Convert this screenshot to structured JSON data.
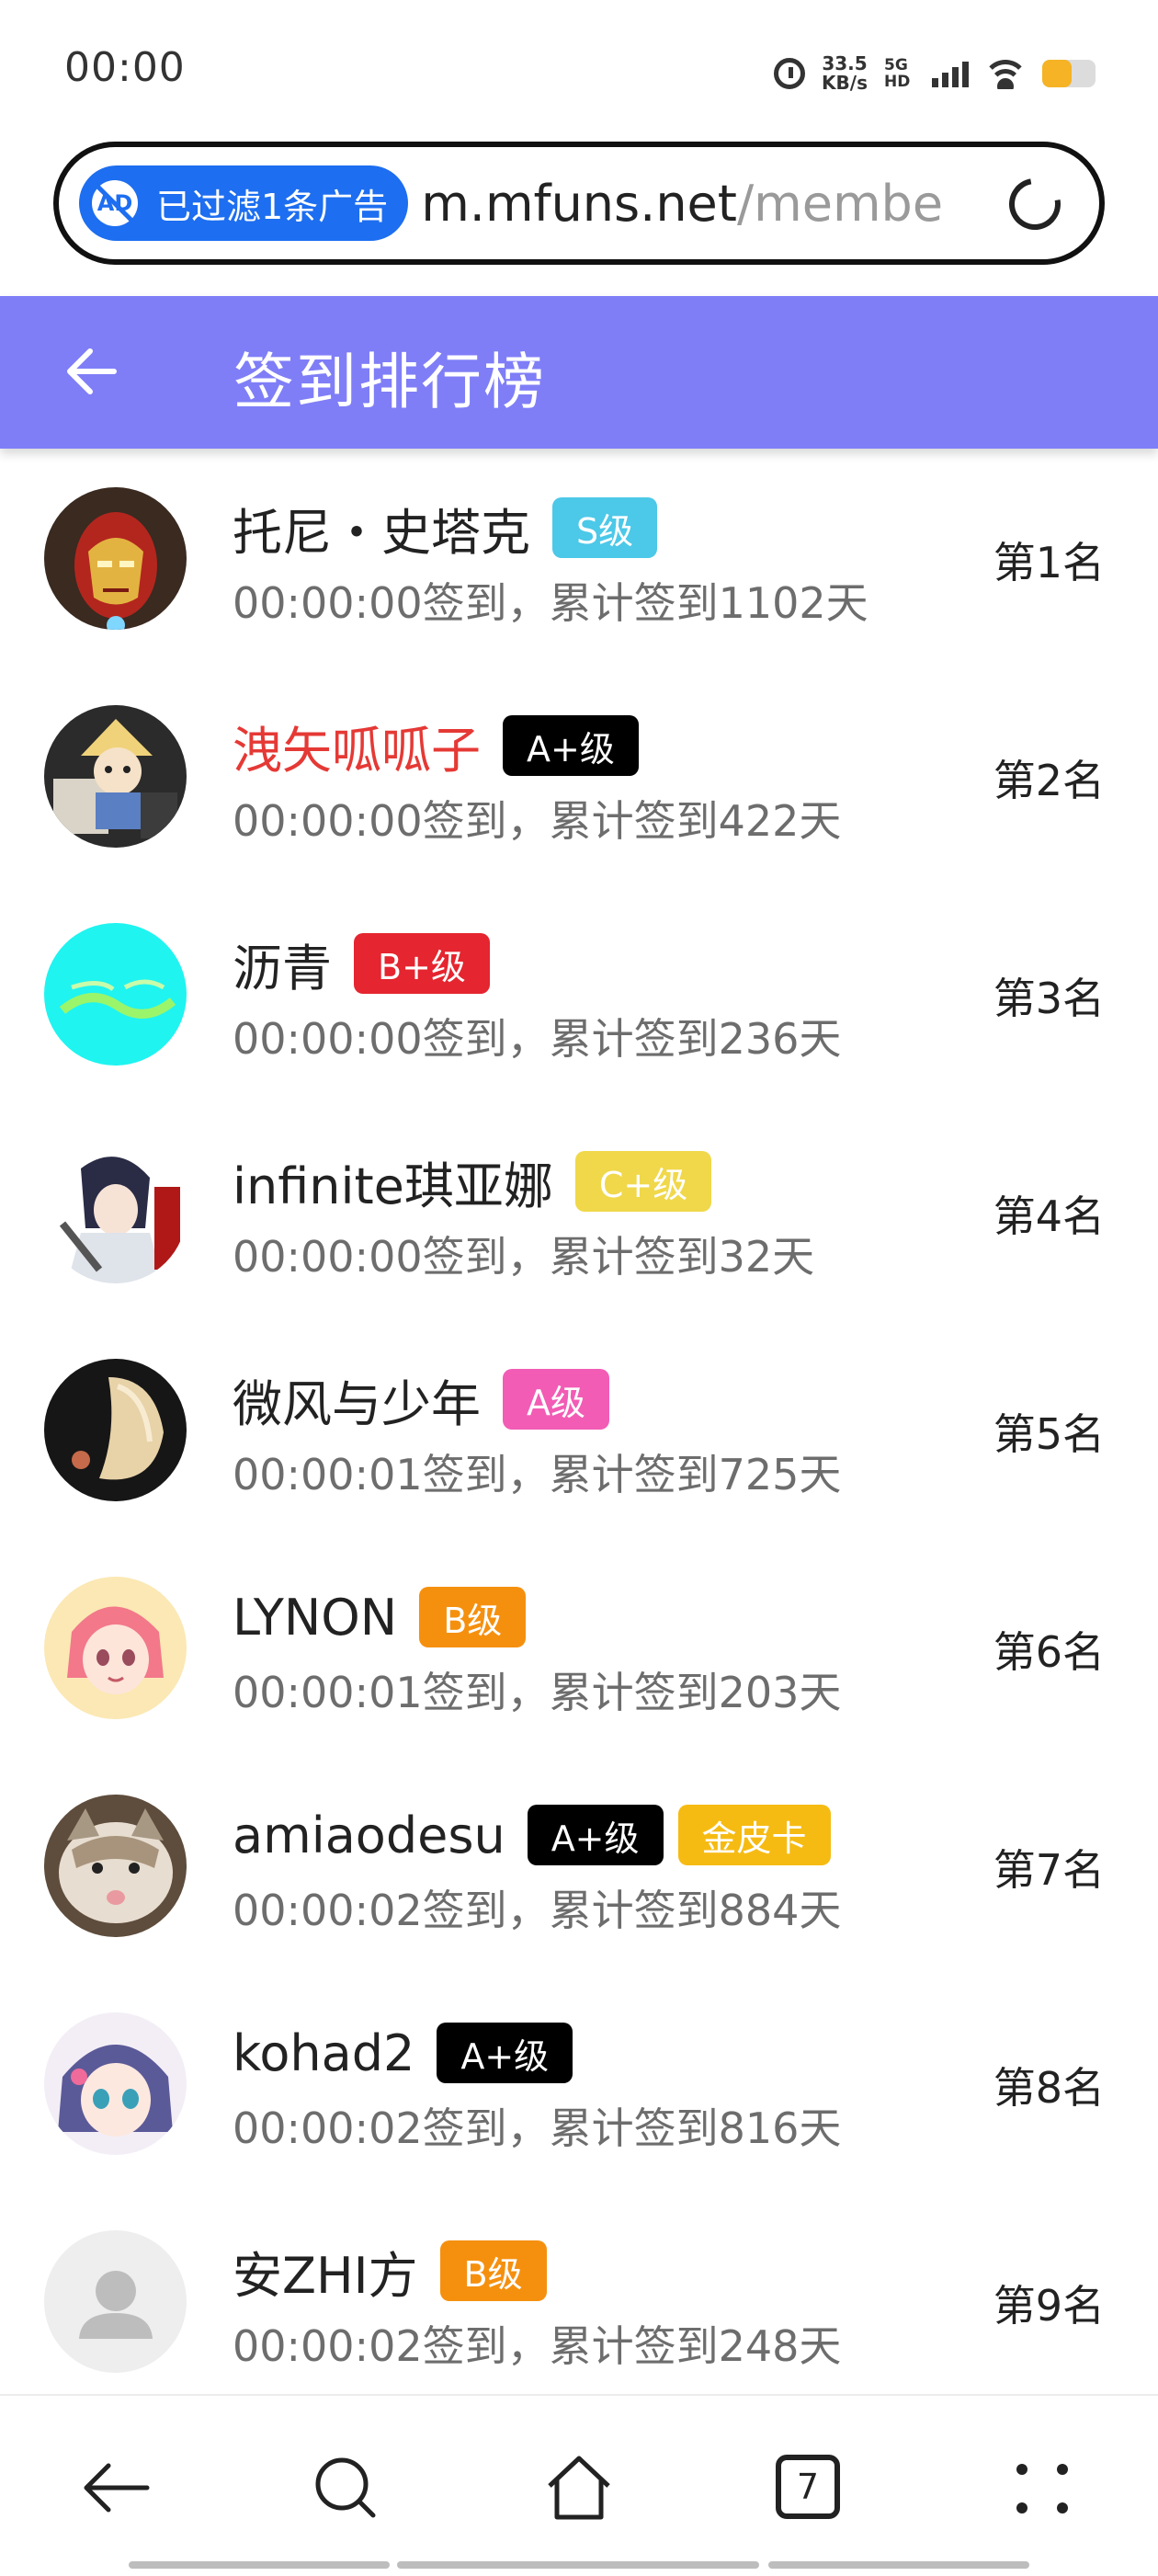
{
  "status_bar": {
    "time": "00:00",
    "net_speed": "33.5",
    "net_speed_unit": "KB/s",
    "network_type": "5G HD",
    "battery_level": 0.55,
    "battery_color": "#f5b325"
  },
  "address_bar": {
    "ad_filter_label": "已过滤1条广告",
    "ad_icon_text": "AD",
    "url_host": "m.mfuns.net",
    "url_path": "/membe",
    "reload_icon": "reload-icon"
  },
  "header": {
    "title": "签到排行榜",
    "back_icon": "back-arrow-icon",
    "background": "#7f7ef7"
  },
  "ranking": [
    {
      "name": "托尼・史塔克",
      "name_color": "#222222",
      "badges": [
        {
          "label": "S级",
          "color": "#4cc8e8"
        }
      ],
      "meta": "00:00:00签到，累计签到1102天",
      "rank": "第1名"
    },
    {
      "name": "洩矢呱呱子",
      "name_color": "#e53935",
      "badges": [
        {
          "label": "A+级",
          "color": "#000000"
        }
      ],
      "meta": "00:00:00签到，累计签到422天",
      "rank": "第2名"
    },
    {
      "name": "沥青",
      "name_color": "#222222",
      "badges": [
        {
          "label": "B+级",
          "color": "#e5252f"
        }
      ],
      "meta": "00:00:00签到，累计签到236天",
      "rank": "第3名"
    },
    {
      "name": "infinite琪亚娜",
      "name_color": "#222222",
      "badges": [
        {
          "label": "C+级",
          "color": "#f0d84a"
        }
      ],
      "meta": "00:00:00签到，累计签到32天",
      "rank": "第4名"
    },
    {
      "name": "微风与少年",
      "name_color": "#222222",
      "badges": [
        {
          "label": "A级",
          "color": "#f25cb5"
        }
      ],
      "meta": "00:00:01签到，累计签到725天",
      "rank": "第5名"
    },
    {
      "name": "LYNON",
      "name_color": "#222222",
      "badges": [
        {
          "label": "B级",
          "color": "#f5900f"
        }
      ],
      "meta": "00:00:01签到，累计签到203天",
      "rank": "第6名"
    },
    {
      "name": "amiaodesu",
      "name_color": "#222222",
      "badges": [
        {
          "label": "A+级",
          "color": "#000000"
        },
        {
          "label": "金皮卡",
          "color": "#f6bb12"
        }
      ],
      "meta": "00:00:02签到，累计签到884天",
      "rank": "第7名"
    },
    {
      "name": "kohad2",
      "name_color": "#222222",
      "badges": [
        {
          "label": "A+级",
          "color": "#000000"
        }
      ],
      "meta": "00:00:02签到，累计签到816天",
      "rank": "第8名"
    },
    {
      "name": "安ZHI方",
      "name_color": "#222222",
      "badges": [
        {
          "label": "B级",
          "color": "#f5900f"
        }
      ],
      "meta": "00:00:02签到，累计签到248天",
      "rank": "第9名"
    }
  ],
  "bottom_nav": {
    "items": [
      "back-icon",
      "search-icon",
      "home-icon",
      "tabs-icon",
      "more-icon"
    ],
    "tab_count": "7"
  }
}
